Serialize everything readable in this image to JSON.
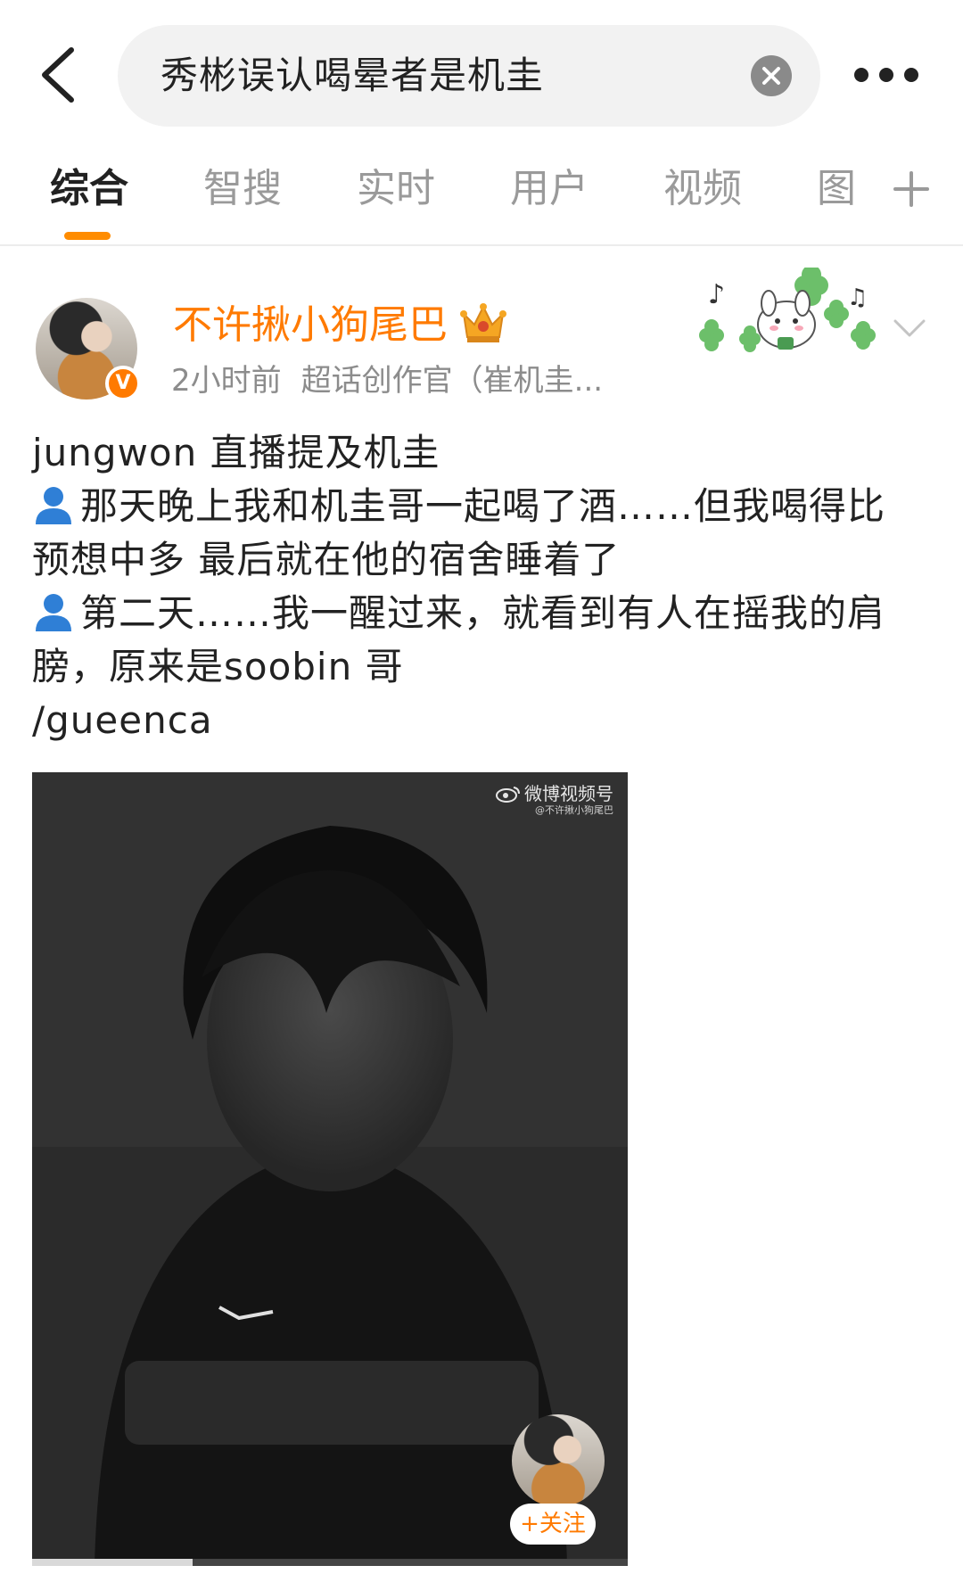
{
  "search": {
    "query": "秀彬误认喝晕者是机圭"
  },
  "tabs": [
    {
      "label": "综合",
      "active": true
    },
    {
      "label": "智搜",
      "active": false
    },
    {
      "label": "实时",
      "active": false
    },
    {
      "label": "用户",
      "active": false
    },
    {
      "label": "视频",
      "active": false
    },
    {
      "label": "图",
      "active": false
    }
  ],
  "post": {
    "username": "不许揪小狗尾巴",
    "time": "2小时前",
    "source": "超话创作官（崔机圭...",
    "badge_letter": "V",
    "lines": [
      {
        "icon": "",
        "text": "jungwon 直播提及机圭"
      },
      {
        "icon": "person-icon",
        "text": "那天晚上我和机圭哥一起喝了酒……但我喝得比"
      },
      {
        "icon": "",
        "text": "预想中多 最后就在他的宿舍睡着了"
      },
      {
        "icon": "person-icon",
        "text": "第二天……我一醒过来，就看到有人在摇我的肩"
      },
      {
        "icon": "",
        "text": "膀，原来是soobin 哥"
      },
      {
        "icon": "",
        "text": "/gueenca"
      }
    ]
  },
  "video": {
    "watermark_title": "微博视频号",
    "watermark_sub": "@不许揪小狗尾巴",
    "follow_label": "+关注",
    "progress": 0.27
  },
  "colors": {
    "accent": "#ff7a00",
    "tab_indicator": "#ff8c00",
    "person_icon": "#2f7fd6"
  }
}
